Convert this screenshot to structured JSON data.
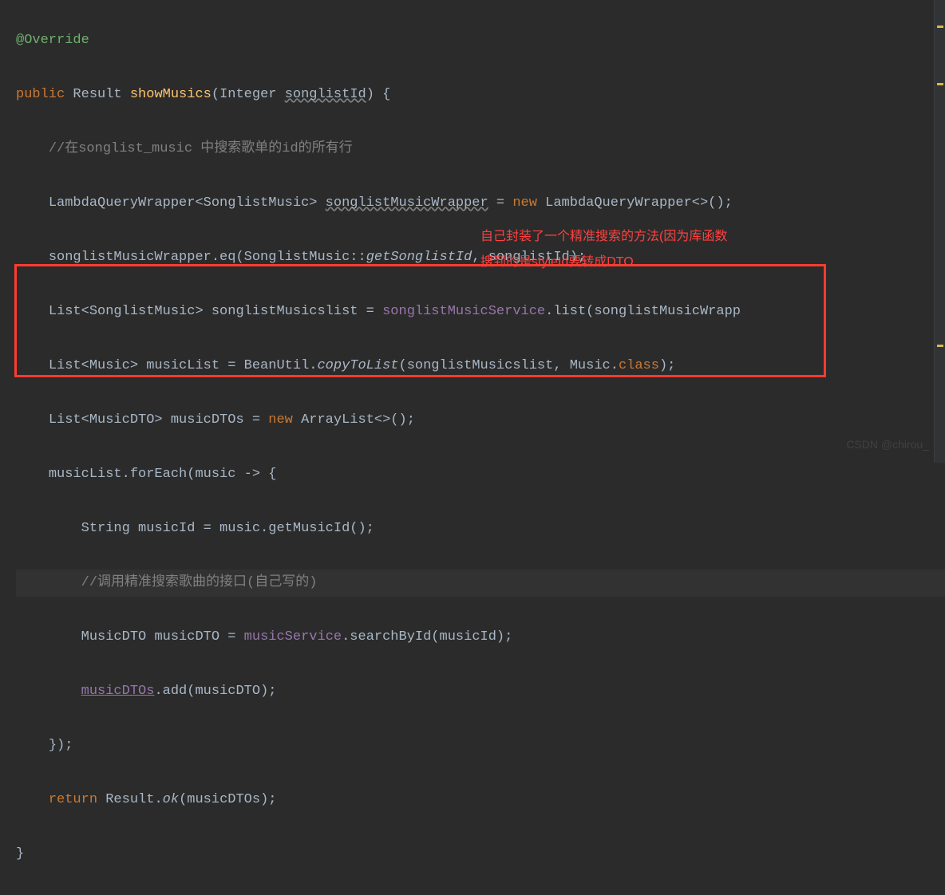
{
  "code": {
    "override": "@Override",
    "kw_public": "public",
    "type_result": "Result",
    "method_name": "showMusics",
    "p_type": "Integer",
    "p_name": "songlistId",
    "brace_open": " {",
    "c1": "//在songlist_music 中搜索歌单的id的所有行",
    "l3a": "LambdaQueryWrapper<SonglistMusic> ",
    "l3b": "songlistMusicWrapper",
    "l3c": " = ",
    "kw_new": "new",
    "l3d": " LambdaQueryWrapper<>();",
    "l4": "songlistMusicWrapper.eq(SonglistMusic::",
    "l4b": "getSonglistId",
    "l4c": ", songlistId);",
    "l5a": "List<SonglistMusic> songlistMusicslist = ",
    "l5b": "songlistMusicService",
    "l5c": ".list(songlistMusicWrapp",
    "l6a": "List<Music> musicList = BeanUtil.",
    "l6b": "copyToList",
    "l6c": "(songlistMusicslist, Music.",
    "l6d": "class",
    "l6e": ");",
    "l7a": "List<MusicDTO> musicDTOs = ",
    "l7b": " ArrayList<>();",
    "l8": "musicList.forEach(music -> {",
    "l9a": "String musicId = music.getMusicId();",
    "c2": "//调用精准搜索歌曲的接口(自己写的)",
    "l11a": "MusicDTO musicDTO = ",
    "l11b": "musicService",
    "l11c": ".searchById(musicId);",
    "l12a": "musicDTOs",
    "l12b": ".add(musicDTO);",
    "l13": "});",
    "kw_return": "return",
    "l14a": " Result.",
    "l14b": "ok",
    "l14c": "(musicDTOs);",
    "brace_close": "}"
  },
  "annot": {
    "a1": "自己封装了一个精准搜索的方法(因为库函数",
    "a2": "搜到的是styleId要转成DTO"
  },
  "watermark": "CSDN @chirou_"
}
